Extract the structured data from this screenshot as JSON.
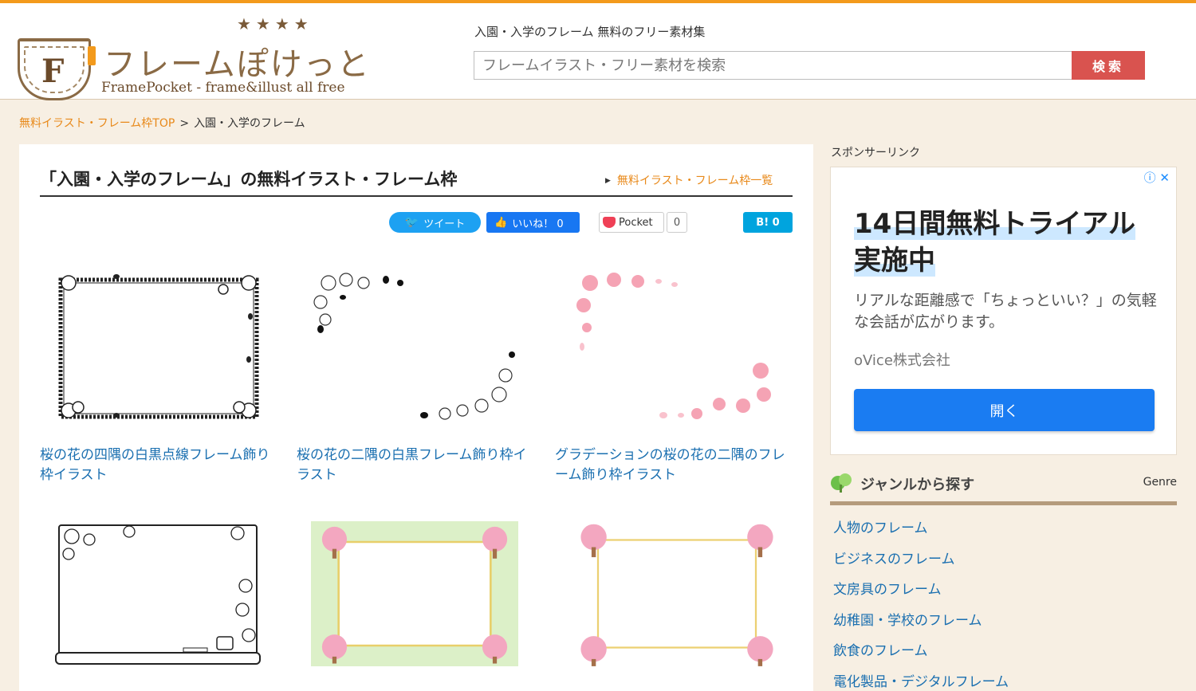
{
  "colors": {
    "accent": "#f39a1c",
    "link": "#1a6fb0",
    "orange_link": "#e8891a",
    "search_button": "#d9534f",
    "background": "#f7efe3"
  },
  "logo": {
    "stars": "★★★★",
    "title": "フレームぽけっと",
    "letter": "F",
    "subtitle": "FramePocket - frame&illust all free"
  },
  "header": {
    "tagline": "入園・入学のフレーム 無料のフリー素材集",
    "search": {
      "placeholder": "フレームイラスト・フリー素材を検索",
      "button": "検索"
    }
  },
  "breadcrumb": {
    "home": "無料イラスト・フレーム枠TOP",
    "separator": ">",
    "current": "入園・入学のフレーム"
  },
  "main": {
    "title": "「入園・入学のフレーム」の無料イラスト・フレーム枠",
    "all_link": "無料イラスト・フレーム枠一覧",
    "social": {
      "tweet": "ツイート",
      "like": "いいね！ 0",
      "pocket": "Pocket",
      "pocket_count": "0",
      "hatena": "B! 0"
    },
    "cards": [
      {
        "caption": "桜の花の四隅の白黒点線フレーム飾り枠イラスト",
        "thumb_icon": "cherry-blossom-bw-dotted-frame"
      },
      {
        "caption": "桜の花の二隅の白黒フレーム飾り枠イラスト",
        "thumb_icon": "cherry-blossom-bw-corner-frame"
      },
      {
        "caption": "グラデーションの桜の花の二隅のフレーム飾り枠イラスト",
        "thumb_icon": "cherry-blossom-pink-corner-frame"
      },
      {
        "caption": "",
        "thumb_icon": "blackboard-cherry-blossom-frame"
      },
      {
        "caption": "",
        "thumb_icon": "cherry-tree-green-frame"
      },
      {
        "caption": "",
        "thumb_icon": "cherry-tree-ribbon-frame"
      }
    ]
  },
  "sidebar": {
    "sponsor_label": "スポンサーリンク",
    "ad": {
      "icons": "ⓘ ✕",
      "headline": "14日間無料トライアル実施中",
      "description": "リアルな距離感で「ちょっといい？」の気軽な会話が広がります。",
      "company": "oVice株式会社",
      "button": "開く"
    },
    "genre": {
      "label": "ジャンルから探す",
      "label_en": "Genre",
      "items": [
        "人物のフレーム",
        "ビジネスのフレーム",
        "文房具のフレーム",
        "幼稚園・学校のフレーム",
        "飲食のフレーム",
        "電化製品・デジタルフレーム"
      ]
    }
  }
}
